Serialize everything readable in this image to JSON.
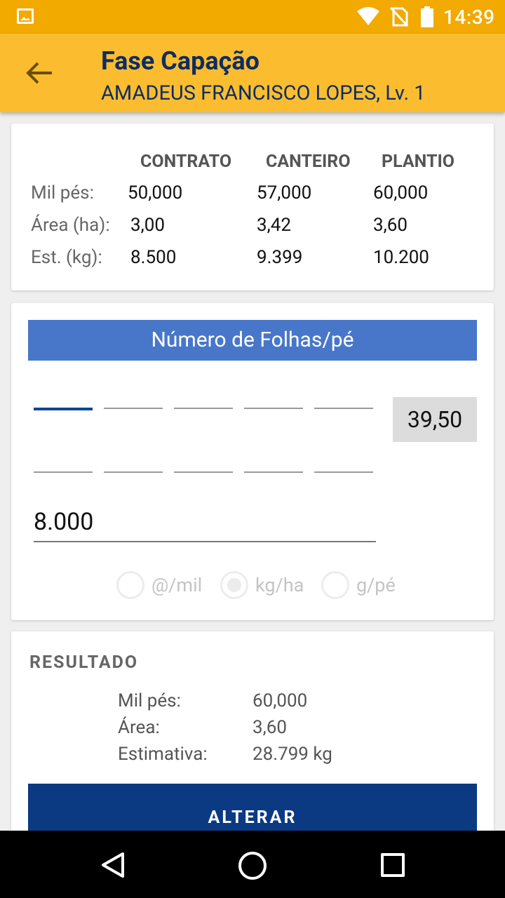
{
  "status_bar": {
    "time": "14:39"
  },
  "app_bar": {
    "title": "Fase Capação",
    "subtitle": "AMADEUS FRANCISCO LOPES, Lv. 1"
  },
  "summary": {
    "columns": [
      "CONTRATO",
      "CANTEIRO",
      "PLANTIO"
    ],
    "rows": [
      {
        "label": "Mil pés:",
        "values": [
          "50,000",
          "57,000",
          "60,000"
        ]
      },
      {
        "label": "Área (ha):",
        "values": [
          "3,00",
          "3,42",
          "3,60"
        ]
      },
      {
        "label": "Est. (kg):",
        "values": [
          "8.500",
          "9.399",
          "10.200"
        ]
      }
    ]
  },
  "input_card": {
    "banner": "Número de Folhas/pé",
    "total": "39,50",
    "main_value": "8.000",
    "radios": [
      {
        "label": "@/mil",
        "selected": false
      },
      {
        "label": "kg/ha",
        "selected": true
      },
      {
        "label": "g/pé",
        "selected": false
      }
    ]
  },
  "result": {
    "title": "RESULTADO",
    "rows": [
      {
        "label": "Mil pés:",
        "value": "60,000"
      },
      {
        "label": "Área:",
        "value": "3,60"
      },
      {
        "label": "Estimativa:",
        "value": "28.799 kg"
      }
    ],
    "button_label": "ALTERAR"
  }
}
